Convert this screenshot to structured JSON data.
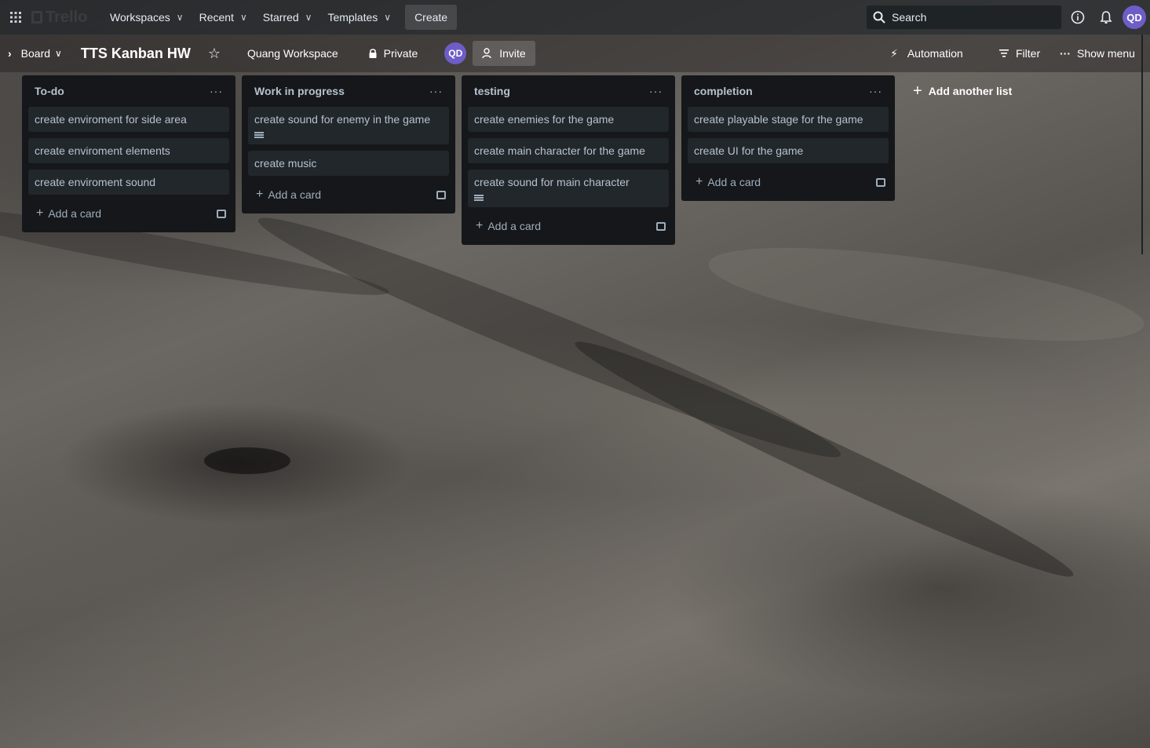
{
  "topbar": {
    "app_name": "Trello",
    "nav": [
      {
        "label": "Workspaces"
      },
      {
        "label": "Recent"
      },
      {
        "label": "Starred"
      },
      {
        "label": "Templates"
      }
    ],
    "create_label": "Create",
    "search_label": "Search",
    "avatar_initials": "QD"
  },
  "board": {
    "view_label": "Board",
    "title": "TTS Kanban HW",
    "workspace_label": "Quang Workspace",
    "visibility_label": "Private",
    "member_initials": "QD",
    "invite_label": "Invite",
    "automation_label": "Automation",
    "filter_label": "Filter",
    "show_menu_label": "Show menu"
  },
  "lists": [
    {
      "title": "To-do",
      "cards": [
        {
          "text": "create enviroment for side area"
        },
        {
          "text": "create enviroment elements"
        },
        {
          "text": "create enviroment sound"
        }
      ]
    },
    {
      "title": "Work in progress",
      "cards": [
        {
          "text": "create sound for enemy in the game",
          "has_description": true
        },
        {
          "text": "create music"
        }
      ]
    },
    {
      "title": "testing",
      "cards": [
        {
          "text": "create enemies for the game"
        },
        {
          "text": "create main character for the game"
        },
        {
          "text": "create sound for main character",
          "has_description": true
        }
      ]
    },
    {
      "title": "completion",
      "cards": [
        {
          "text": "create playable stage for the game"
        },
        {
          "text": "create UI for the game"
        }
      ]
    }
  ],
  "add_card_label": "Add a card",
  "add_list_label": "Add another list",
  "colors": {
    "list_bg": "#15171a",
    "card_bg": "#22272b",
    "avatar": "#6e5dc6"
  }
}
